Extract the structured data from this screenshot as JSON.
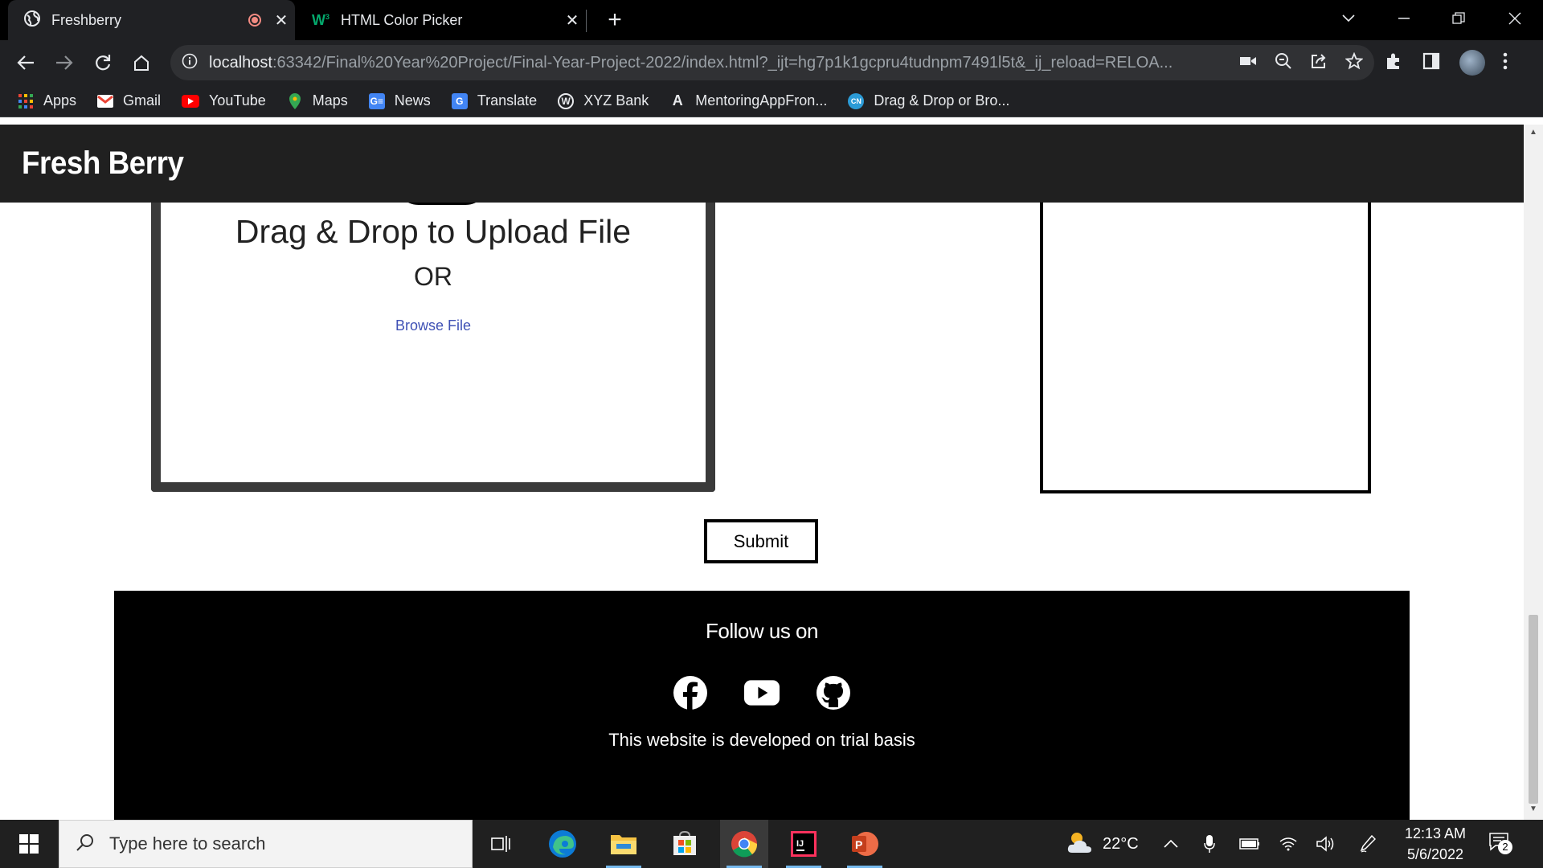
{
  "browser": {
    "tabs": [
      {
        "title": "Freshberry",
        "active": true
      },
      {
        "title": "HTML Color Picker",
        "active": false
      }
    ],
    "address": {
      "host": "localhost",
      "rest": ":63342/Final%20Year%20Project/Final-Year-Project-2022/index.html?_ijt=hg7p1k1gcpru4tudnpm7491l5t&_ij_reload=RELOA..."
    },
    "bookmarks": [
      {
        "label": "Apps",
        "icon": "apps-grid-icon"
      },
      {
        "label": "Gmail",
        "icon": "gmail-icon"
      },
      {
        "label": "YouTube",
        "icon": "youtube-icon"
      },
      {
        "label": "Maps",
        "icon": "maps-icon"
      },
      {
        "label": "News",
        "icon": "news-icon"
      },
      {
        "label": "Translate",
        "icon": "translate-icon"
      },
      {
        "label": "XYZ Bank",
        "icon": "wordpress-icon"
      },
      {
        "label": "MentoringAppFron...",
        "icon": "a-icon"
      },
      {
        "label": "Drag & Drop or Bro...",
        "icon": "cn-icon"
      }
    ]
  },
  "page": {
    "site_title": "Fresh Berry",
    "upload": {
      "title": "Drag & Drop to Upload File",
      "or": "OR",
      "browse": "Browse File"
    },
    "submit": "Submit",
    "footer": {
      "follow": "Follow us on",
      "socials": [
        "facebook-icon",
        "youtube-icon",
        "github-icon"
      ],
      "note": "This website is developed on trial basis"
    }
  },
  "taskbar": {
    "search_placeholder": "Type here to search",
    "weather": "22°C",
    "time": "12:13 AM",
    "date": "5/6/2022",
    "notifications": "2"
  },
  "colors": {
    "site_header": "#202020",
    "footer": "#000000",
    "link": "#3f51b5"
  }
}
